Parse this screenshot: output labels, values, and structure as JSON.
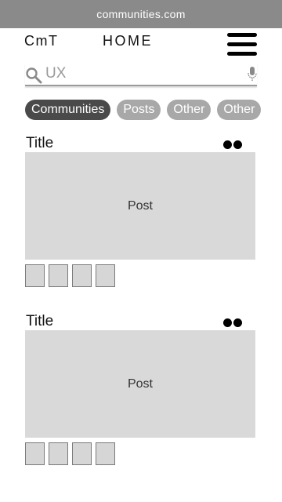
{
  "browser": {
    "url": "communities.com"
  },
  "header": {
    "logo": "CmT",
    "title": "HOME",
    "menu_icon": "hamburger-menu-icon"
  },
  "search": {
    "value": "",
    "placeholder": "UX",
    "search_icon": "search-icon",
    "mic_icon": "microphone-icon"
  },
  "filters": [
    {
      "label": "Communities",
      "active": true
    },
    {
      "label": "Posts",
      "active": false
    },
    {
      "label": "Other",
      "active": false
    },
    {
      "label": "Other",
      "active": false
    }
  ],
  "feed": [
    {
      "title": "Title",
      "post": "Post",
      "more_icon": "more-dots-icon",
      "thumbnails": 4
    },
    {
      "title": "Title",
      "post": "Post",
      "more_icon": "more-dots-icon",
      "thumbnails": 4
    }
  ],
  "colors": {
    "topbar": "#8a8a8a",
    "chip_active": "#4a4a4a",
    "chip": "#a8a8a8",
    "placeholder_box": "#d9d9d9"
  }
}
